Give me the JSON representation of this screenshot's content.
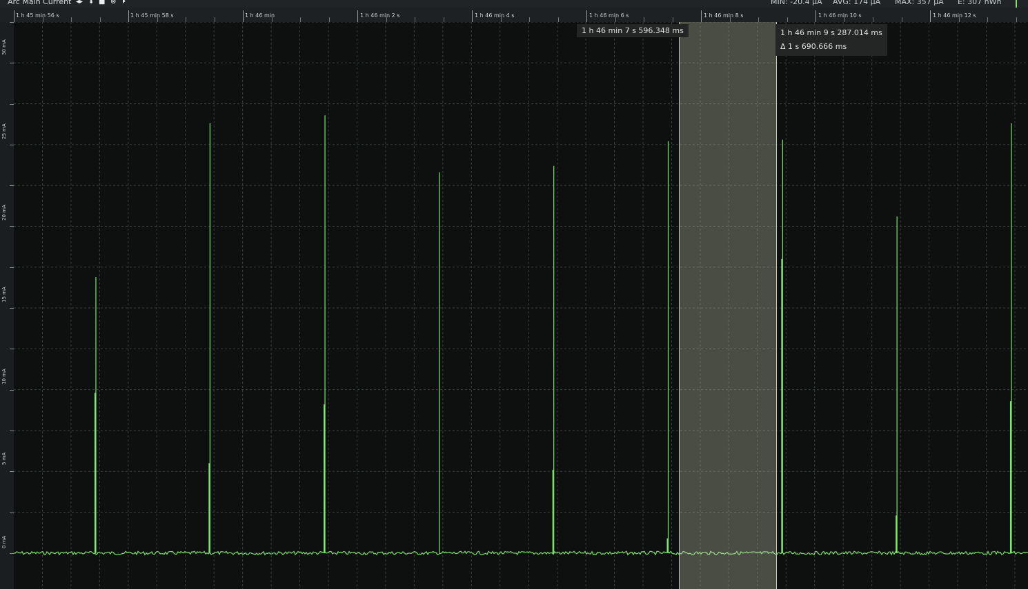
{
  "channel": {
    "title": "Arc Main Current",
    "controls": [
      {
        "icon": "pan-horizontal-icon",
        "glyph": "◂▸"
      },
      {
        "icon": "pan-vertical-icon",
        "glyph": "⬍"
      },
      {
        "icon": "stop-icon",
        "glyph": "■"
      },
      {
        "icon": "close-circle-icon",
        "glyph": "⊗"
      },
      {
        "icon": "step-forward-icon",
        "glyph": "⏵"
      }
    ],
    "stats": {
      "min": "MIN: -20.4 µA",
      "avg": "AVG: 174 µA",
      "max": "MAX: 357 µA",
      "energy": "E: 307 nWh"
    }
  },
  "time_axis": {
    "labels": [
      "1 h 45 min 56 s",
      "1 h 45 min 58 s",
      "1 h 46 min",
      "1 h 46 min 2 s",
      "1 h 46 min 4 s",
      "1 h 46 min 6 s",
      "1 h 46 min 8 s",
      "1 h 46 min 10 s",
      "1 h 46 min 12 s"
    ]
  },
  "y_axis": {
    "labels": [
      "30 mA",
      "25 mA",
      "20 mA",
      "15 mA",
      "10 mA",
      "5 mA",
      "0 mA"
    ]
  },
  "cursors": {
    "left_label": "1 h 46 min 7 s 596.348 ms",
    "right_label": "1 h 46 min 9 s 287.014 ms",
    "delta_label": "Δ 1 s 690.666 ms"
  },
  "colors": {
    "trace": "#7ee86a",
    "background": "#0d100e",
    "grid": "#3a403d",
    "selection": "#c8ccb4"
  },
  "chart_data": {
    "type": "line",
    "x_unit": "s",
    "xlim": [
      0,
      17.73
    ],
    "ylim": [
      -2.2,
      32.5
    ],
    "y_unit": "mA",
    "baseline_mA": 0.0,
    "spikes": [
      {
        "t": 1.435,
        "peak_mA": 16.9,
        "secondary_mA": 9.8
      },
      {
        "t": 3.43,
        "peak_mA": 26.3,
        "secondary_mA": 5.5
      },
      {
        "t": 5.44,
        "peak_mA": 26.8,
        "secondary_mA": 9.1
      },
      {
        "t": 7.44,
        "peak_mA": 23.3,
        "secondary_mA": null
      },
      {
        "t": 9.44,
        "peak_mA": 23.7,
        "secondary_mA": 5.1
      },
      {
        "t": 11.44,
        "peak_mA": 25.2,
        "secondary_mA": 0.9
      },
      {
        "t": 13.44,
        "peak_mA": 25.3,
        "secondary_mA": 18.0
      },
      {
        "t": 15.44,
        "peak_mA": 20.6,
        "secondary_mA": 2.3
      },
      {
        "t": 17.44,
        "peak_mA": 26.3,
        "secondary_mA": 9.3
      }
    ],
    "selection": {
      "t_start": 11.63,
      "t_end": 13.32
    }
  }
}
